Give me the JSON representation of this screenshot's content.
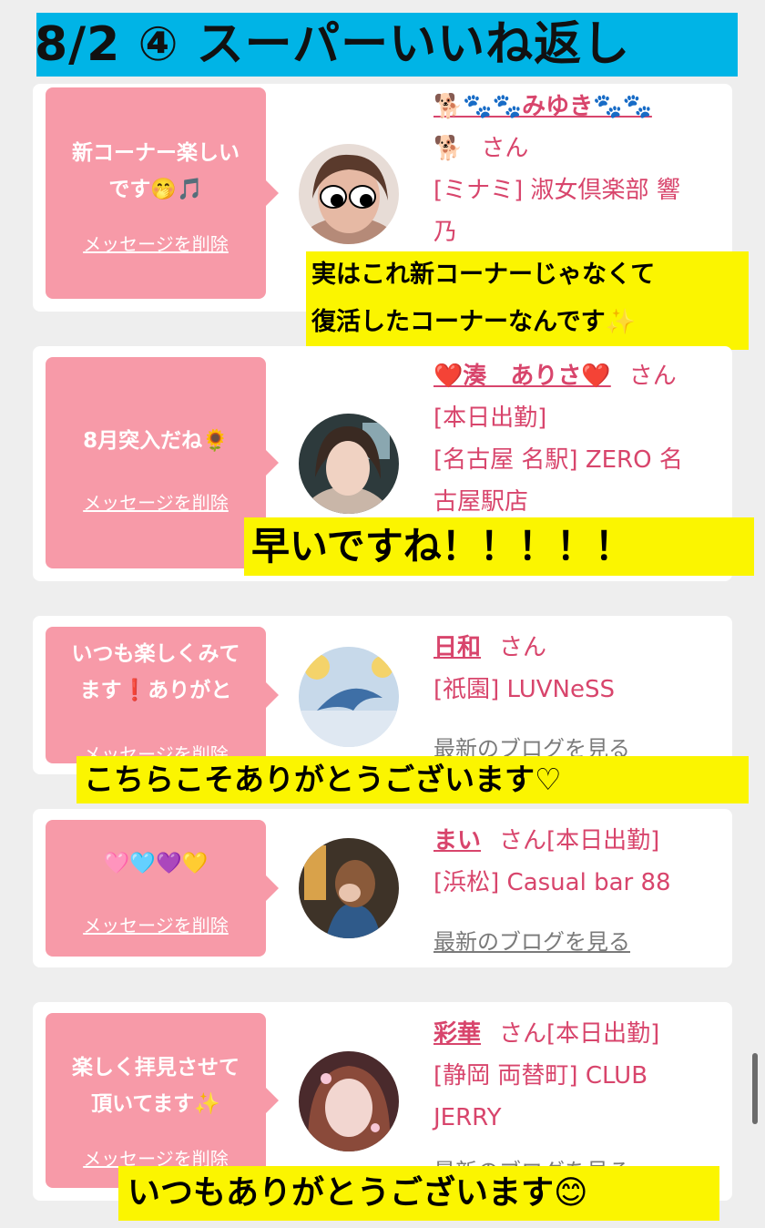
{
  "title": "8/2 ④ スーパーいいね返し",
  "colors": {
    "accent_pink": "#d8456c",
    "bubble": "#f79aa8",
    "highlight": "#fbf500",
    "banner": "#00b4e6"
  },
  "delete_label": "メッセージを削除",
  "blog_label": "最新のブログを見る",
  "san_label": "さん",
  "cards": [
    {
      "message_line1": "新コーナー楽しい",
      "message_line2": "です🤭🎵",
      "name": "🐕🐾🐾みゆき🐾🐾",
      "name_line2": "🐕",
      "shop_line1": "[ミナミ] 淑女倶楽部 響",
      "shop_line2": "乃",
      "note_line1": "実はこれ新コーナーじゃなくて",
      "note_line2": "復活したコーナーなんです✨"
    },
    {
      "message_line1": "8月突入だね🌻",
      "name": "❤️湊　ありさ❤️",
      "status": "[本日出勤]",
      "shop_line1": "[名古屋 名駅] ZERO 名",
      "shop_line2": "古屋駅店",
      "note_line1": "早いですね！！！！！"
    },
    {
      "message_line1": "いつも楽しくみて",
      "message_line2": "ます❗️ありがと",
      "name": "日和",
      "shop_line1": "[祇園] LUVNeSS",
      "note_line1": "こちらこそありがとうございます♡"
    },
    {
      "message_line1": "🩷🩵💜💛",
      "name": "まい",
      "status": "[本日出勤]",
      "shop_line1": "[浜松] Casual bar 88"
    },
    {
      "message_line1": "楽しく拝見させて",
      "message_line2": "頂いてます✨",
      "name": "彩華",
      "status": "[本日出勤]",
      "shop_line1": "[静岡 両替町] CLUB",
      "shop_line2": "JERRY",
      "note_line1": "いつもありがとうございます😊"
    }
  ]
}
